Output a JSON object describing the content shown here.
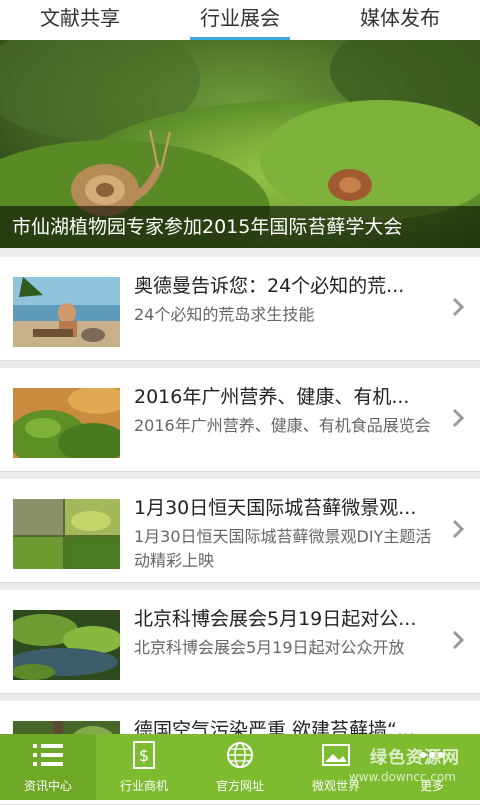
{
  "tabs": [
    {
      "label": "文献共享"
    },
    {
      "label": "行业展会"
    },
    {
      "label": "媒体发布"
    }
  ],
  "banner": {
    "caption": "市仙湖植物园专家参加2015年国际苔藓学大会"
  },
  "list": [
    {
      "title": "奥德曼告诉您：24个必知的荒...",
      "subtitle": "24个必知的荒岛求生技能"
    },
    {
      "title": "2016年广州营养、健康、有机...",
      "subtitle": "2016年广州营养、健康、有机食品展览会"
    },
    {
      "title": "1月30日恒天国际城苔藓微景观...",
      "subtitle": "1月30日恒天国际城苔藓微景观DIY主题活动精彩上映"
    },
    {
      "title": "北京科博会展会5月19日起对公...",
      "subtitle": "北京科博会展会5月19日起对公众开放"
    },
    {
      "title": "德国空气污染严重 欲建苔藓墙“..."
    }
  ],
  "bottom_nav": [
    {
      "label": "资讯中心",
      "icon": "list-icon"
    },
    {
      "label": "行业商机",
      "icon": "dollar-doc-icon"
    },
    {
      "label": "官方网址",
      "icon": "globe-icon"
    },
    {
      "label": "微观世界",
      "icon": "image-icon"
    },
    {
      "label": "更多",
      "icon": "more-icon"
    }
  ],
  "watermark": {
    "title": "绿色资源网",
    "url": "www.downcc.com"
  },
  "colors": {
    "accent": "#3fa8e0",
    "nav_bg": "#7dbb2f"
  }
}
